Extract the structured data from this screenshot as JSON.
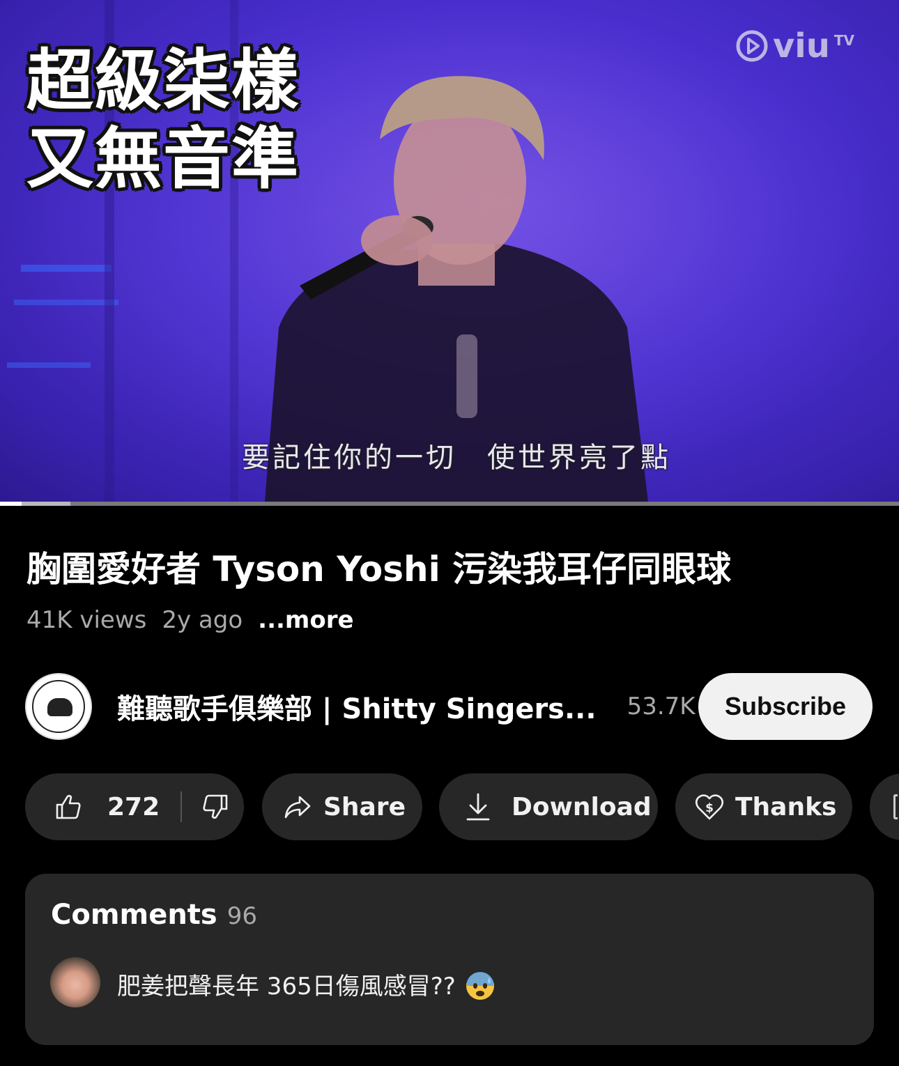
{
  "video": {
    "overlay_caption": "超級柒樣\n又無音準",
    "logo_text": "viu",
    "logo_suffix": "TV",
    "subtitle": "要記住你的一切　使世界亮了點",
    "progress": {
      "played_fraction": 0.024,
      "buffered_fraction": 0.078
    }
  },
  "info": {
    "title": "胸圍愛好者 Tyson Yoshi 污染我耳仔同眼球",
    "views": "41K views",
    "age": "2y ago",
    "more": "...more"
  },
  "channel": {
    "name": "難聽歌手俱樂部 | Shitty Singers...",
    "subscribers": "53.7K",
    "subscribe_label": "Subscribe"
  },
  "actions": {
    "like_count": "272",
    "share_label": "Share",
    "download_label": "Download",
    "thanks_label": "Thanks"
  },
  "comments": {
    "title": "Comments",
    "count": "96",
    "top_comment": "肥姜把聲長年 365日傷風感冒??"
  },
  "icons": [
    "thumbs-up-icon",
    "thumbs-down-icon",
    "share-arrow-icon",
    "download-icon",
    "thanks-heart-icon",
    "fearful-face-emoji"
  ],
  "colors": {
    "background": "#000000",
    "pill": "#272727",
    "subscribe_bg": "#f1f1f1",
    "secondary_text": "#aaaaaa",
    "video_purple": "#4a2fcf"
  }
}
